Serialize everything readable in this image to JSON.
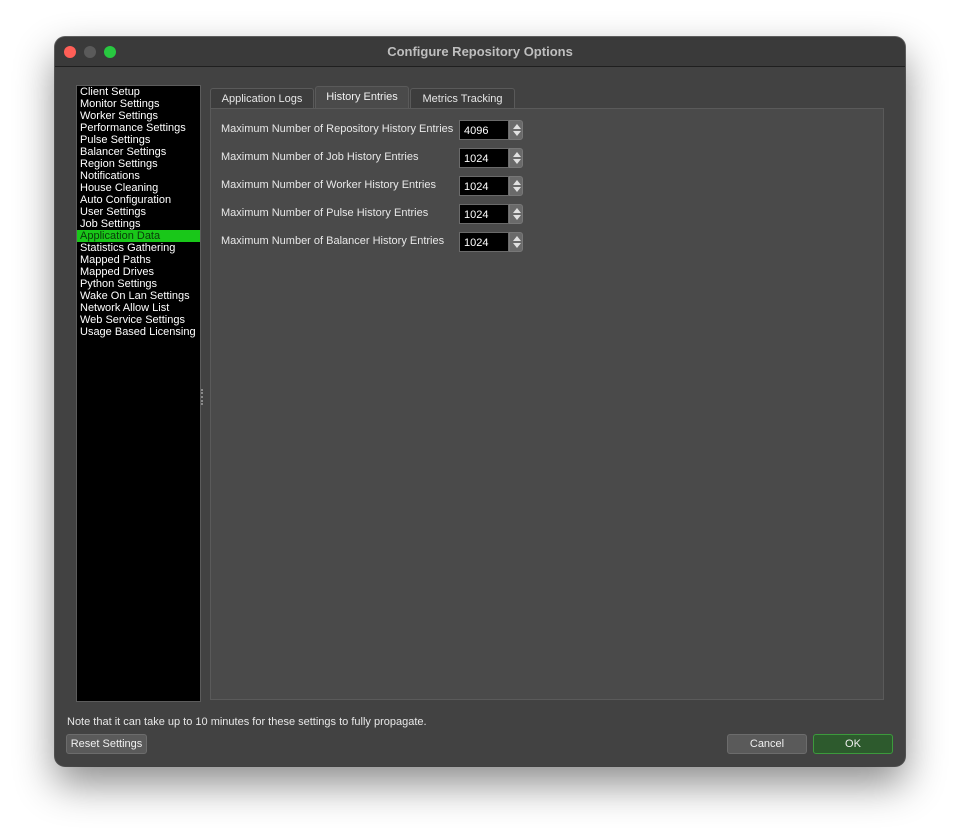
{
  "window": {
    "title": "Configure Repository Options"
  },
  "sidebar": {
    "items": [
      {
        "label": "Client Setup"
      },
      {
        "label": "Monitor Settings"
      },
      {
        "label": "Worker Settings"
      },
      {
        "label": "Performance Settings"
      },
      {
        "label": "Pulse Settings"
      },
      {
        "label": "Balancer Settings"
      },
      {
        "label": "Region Settings"
      },
      {
        "label": "Notifications"
      },
      {
        "label": "House Cleaning"
      },
      {
        "label": "Auto Configuration"
      },
      {
        "label": "User Settings"
      },
      {
        "label": "Job Settings"
      },
      {
        "label": "Application Data",
        "selected": true
      },
      {
        "label": "Statistics Gathering"
      },
      {
        "label": "Mapped Paths"
      },
      {
        "label": "Mapped Drives"
      },
      {
        "label": "Python Settings"
      },
      {
        "label": "Wake On Lan Settings"
      },
      {
        "label": "Network Allow List"
      },
      {
        "label": "Web Service Settings"
      },
      {
        "label": "Usage Based Licensing"
      }
    ],
    "selected_color": "#19c719"
  },
  "tabs": [
    {
      "label": "Application Logs"
    },
    {
      "label": "History Entries",
      "active": true
    },
    {
      "label": "Metrics Tracking"
    }
  ],
  "history": {
    "rows": [
      {
        "label": "Maximum Number of Repository History Entries",
        "value": "4096"
      },
      {
        "label": "Maximum Number of Job History Entries",
        "value": "1024"
      },
      {
        "label": "Maximum Number of Worker History Entries",
        "value": "1024"
      },
      {
        "label": "Maximum Number of Pulse History Entries",
        "value": "1024"
      },
      {
        "label": "Maximum Number of Balancer History Entries",
        "value": "1024"
      }
    ]
  },
  "footer": {
    "note": "Note that it can take up to 10 minutes for these settings to fully propagate.",
    "reset_label": "Reset Settings",
    "cancel_label": "Cancel",
    "ok_label": "OK"
  }
}
